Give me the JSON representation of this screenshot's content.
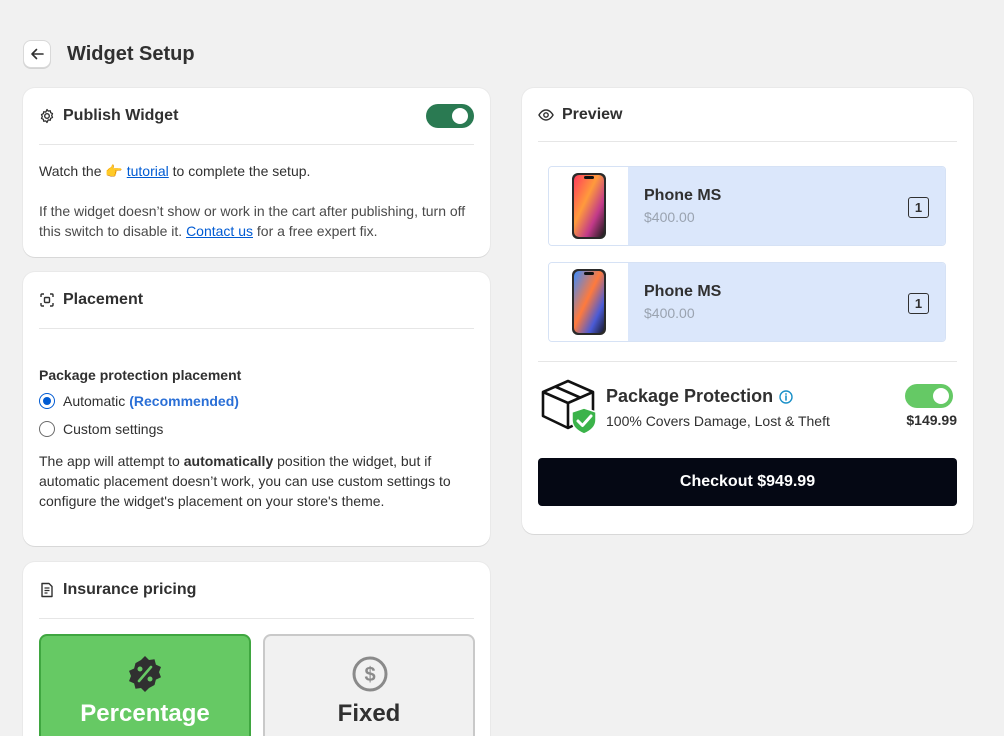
{
  "header": {
    "title": "Widget Setup"
  },
  "publish": {
    "title": "Publish Widget",
    "toggle_on": true,
    "watch_prefix": "Watch the",
    "watch_emoji": "👉",
    "tutorial_link": "tutorial",
    "watch_suffix": "to complete the setup.",
    "note_text": "If the widget doesn’t show or work in the cart after publishing, turn off this switch to disable it.",
    "contact_link": "Contact us",
    "note_suffix": "for a free expert fix."
  },
  "placement": {
    "title": "Placement",
    "section_label": "Package protection placement",
    "option_automatic": "Automatic",
    "option_recommended": "(Recommended)",
    "option_custom": "Custom settings",
    "selected": "automatic",
    "desc_1": "The app will attempt to",
    "desc_bold": "automatically",
    "desc_2": "position the widget, but if automatic placement doesn’t work, you can use custom settings to configure the widget's placement on your store's theme."
  },
  "pricing": {
    "title": "Insurance pricing",
    "option_percentage": "Percentage",
    "option_fixed": "Fixed",
    "selected": "percentage"
  },
  "preview": {
    "title": "Preview",
    "products": [
      {
        "name": "Phone MS",
        "price": "$400.00",
        "qty": "1"
      },
      {
        "name": "Phone MS",
        "price": "$400.00",
        "qty": "1"
      }
    ],
    "protection_title": "Package Protection",
    "protection_desc": "100% Covers Damage, Lost & Theft",
    "protection_price": "$149.99",
    "protection_on": true,
    "checkout_label": "Checkout $949.99"
  },
  "colors": {
    "toggle_dark_green": "#2a7a52",
    "toggle_green": "#65c965",
    "selected_green": "#66c964",
    "link_blue": "#005bd3",
    "checkout_bg": "#050814",
    "product_bg": "#dbe7fb"
  }
}
